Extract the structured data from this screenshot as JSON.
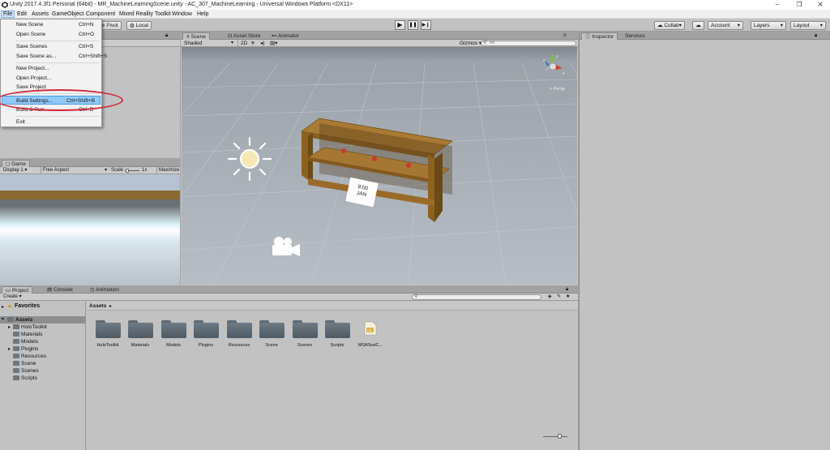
{
  "window": {
    "title": "Unity 2017.4.3f1 Personal (64bit) - MR_MachineLearningScene.unity - AC_307_MachineLearning - Universal Windows Platform <DX11>",
    "minimize": "–",
    "maximize": "❐",
    "close": "✕"
  },
  "menubar": {
    "items": [
      "File",
      "Edit",
      "Assets",
      "GameObject",
      "Component",
      "Mixed Reality Toolkit",
      "Window",
      "Help"
    ]
  },
  "filemenu": {
    "items": [
      {
        "label": "New Scene",
        "shortcut": "Ctrl+N"
      },
      {
        "label": "Open Scene",
        "shortcut": "Ctrl+O"
      },
      {
        "label": "Save Scenes",
        "shortcut": "Ctrl+S"
      },
      {
        "label": "Save Scene as...",
        "shortcut": "Ctrl+Shift+S"
      },
      {
        "label": "New Project...",
        "shortcut": ""
      },
      {
        "label": "Open Project...",
        "shortcut": ""
      },
      {
        "label": "Save Project",
        "shortcut": ""
      },
      {
        "label": "Build Settings...",
        "shortcut": "Ctrl+Shift+B"
      },
      {
        "label": "Build & Run",
        "shortcut": "Ctrl+B"
      },
      {
        "label": "Exit",
        "shortcut": ""
      }
    ]
  },
  "toolbar": {
    "pivot": "Pivot",
    "local": "Local",
    "collab": "Collab",
    "account": "Account",
    "layers": "Layers",
    "layout": "Layout",
    "play_icon": "▶",
    "pause_icon": "❚❚",
    "step_icon": "▶❙"
  },
  "scene": {
    "tabs": [
      "Scene",
      "Asset Store",
      "Animator"
    ],
    "shading": "Shaded",
    "mode2d": "2D",
    "gizmos": "Gizmos",
    "search_placeholder": "All",
    "persp": "< Persp",
    "card_time": "9:00",
    "card_month": "JAN"
  },
  "inspector": {
    "tabs": [
      "Inspector",
      "Services"
    ]
  },
  "game": {
    "tab": "Game",
    "display": "Display 1",
    "aspect": "Free Aspect",
    "scale_label": "Scale",
    "scale_value": "1x",
    "maximize": "Maximize"
  },
  "project": {
    "tabs": [
      "Project",
      "Console",
      "Animation"
    ],
    "create": "Create",
    "favorites": "Favorites",
    "assets_root": "Assets",
    "breadcrumb": "Assets",
    "tree": [
      "HoloToolkit",
      "Materials",
      "Models",
      "Plugins",
      "Resources",
      "Scene",
      "Scenes",
      "Scripts"
    ],
    "folders": [
      "HoloToolkit",
      "Materials",
      "Models",
      "Plugins",
      "Resources",
      "Scene",
      "Scenes",
      "Scripts"
    ],
    "file": "MSATestC..."
  }
}
